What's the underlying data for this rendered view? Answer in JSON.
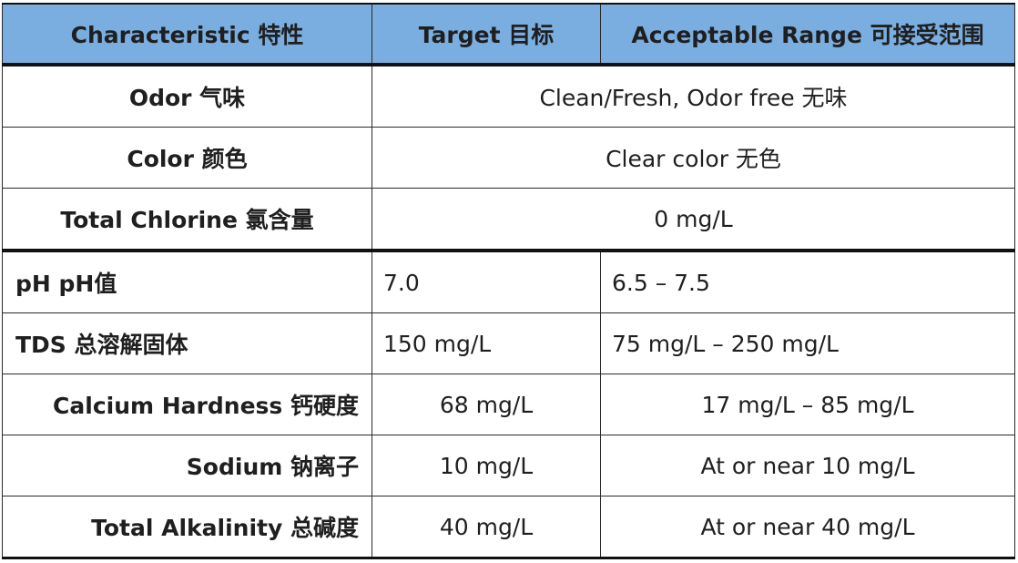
{
  "table": {
    "headers": [
      "Characteristic 特性",
      "Target 目标",
      "Acceptable Range 可接受范围"
    ],
    "merged_rows": [
      {
        "characteristic": "Odor 气味",
        "value": "Clean/Fresh, Odor free 无味"
      },
      {
        "characteristic": "Color 颜色",
        "value": "Clear color 无色"
      },
      {
        "characteristic": "Total Chlorine 氯含量",
        "value": "0 mg/L"
      }
    ],
    "rows": [
      {
        "characteristic": "pH pH值",
        "target": "7.0",
        "range": "6.5 – 7.5"
      },
      {
        "characteristic": "TDS 总溶解固体",
        "target": "150 mg/L",
        "range": "75 mg/L – 250 mg/L"
      },
      {
        "characteristic": "Calcium Hardness 钙硬度",
        "target": "68 mg/L",
        "range": "17 mg/L – 85 mg/L"
      },
      {
        "characteristic": "Sodium 钠离子",
        "target": "10 mg/L",
        "range": "At or near 10 mg/L"
      },
      {
        "characteristic": "Total Alkalinity 总碱度",
        "target": "40 mg/L",
        "range": "At or near 40 mg/L"
      }
    ]
  },
  "colors": {
    "header_bg": "#7aaee0",
    "border": "#2a2a2a",
    "text": "#1f1f1f"
  }
}
